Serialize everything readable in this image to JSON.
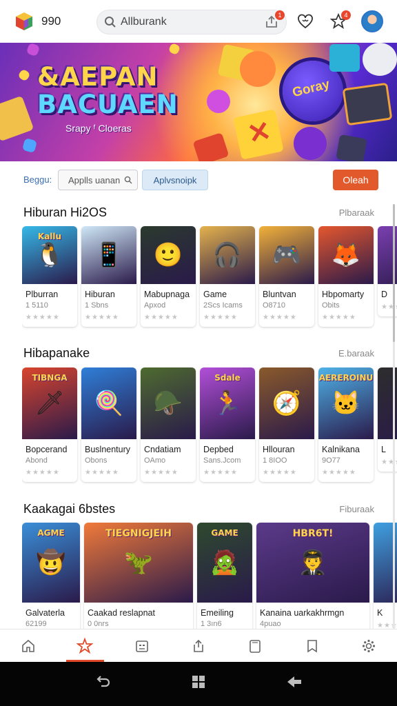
{
  "header": {
    "coins": "990",
    "search_value": "Allburank",
    "share_badge": "1",
    "favorites_badge": "4"
  },
  "banner": {
    "title_line1": "&AEPAN",
    "title_line2": "BACUAEN",
    "subtitle": "Srapy ᶠ Cloeras",
    "ball_text": "Goray"
  },
  "filter": {
    "label": "Beggu:",
    "search_chip": "Applls uanan",
    "active_chip": "Aplvsnoipk",
    "clear_button": "Oleah"
  },
  "sections": [
    {
      "title": "Hiburan Hi2OS",
      "more": "Plbaraak",
      "items": [
        {
          "name": "Plburran",
          "meta": "1 5110",
          "icon": "penguin-game-icon",
          "caption": "Kallu",
          "bg": "#36b9e8"
        },
        {
          "name": "Hiburan",
          "meta": "1 Sbns",
          "icon": "person-phone-icon",
          "caption": "",
          "bg": "#cfe8f7"
        },
        {
          "name": "Mabupnaga",
          "meta": "Apxod",
          "icon": "person-portrait-icon",
          "caption": "",
          "bg": "#2b3a2e"
        },
        {
          "name": "Game",
          "meta": "2Scs Icams",
          "icon": "headphones-girl-icon",
          "caption": "",
          "bg": "#e4b24c"
        },
        {
          "name": "Bluntvan",
          "meta": "O8710",
          "icon": "gamepad-icon",
          "caption": "",
          "bg": "#f2b13a"
        },
        {
          "name": "Hbpomarty",
          "meta": "Obits",
          "icon": "fox-girl-icon",
          "caption": "",
          "bg": "#e4572e"
        },
        {
          "name": "D",
          "meta": "",
          "icon": "partial-card-icon",
          "caption": "",
          "bg": "#7a3fb0"
        }
      ]
    },
    {
      "title": "Hibapanake",
      "more": "E.baraak",
      "items": [
        {
          "name": "Bopcerand",
          "meta": "Abond",
          "icon": "hero-adventure-icon",
          "caption": "TIBNGA",
          "bg": "#d8452e"
        },
        {
          "name": "Buslnentury",
          "meta": "Obons",
          "icon": "popsicle-icon",
          "caption": "",
          "bg": "#2f7fd8"
        },
        {
          "name": "Cndatiam",
          "meta": "OAmo",
          "icon": "soldiers-icon",
          "caption": "",
          "bg": "#4e6b2f"
        },
        {
          "name": "Depbed",
          "meta": "Sans.Jcom",
          "icon": "runner-icon",
          "caption": "Sdale",
          "bg": "#b24fd8"
        },
        {
          "name": "Hllouran",
          "meta": "1 8IOO",
          "icon": "explorer-icon",
          "caption": "",
          "bg": "#8a5a2b"
        },
        {
          "name": "Kalnikana",
          "meta": "9O77",
          "icon": "cat-hero-icon",
          "caption": "AEREROINU",
          "bg": "#4fb2e8"
        },
        {
          "name": "L",
          "meta": "",
          "icon": "partial-card-icon",
          "caption": "",
          "bg": "#2d2d2d"
        }
      ]
    },
    {
      "title": "Kaakagai 6bstes",
      "more": "Fiburaak",
      "items": [
        {
          "name": "Galvaterla",
          "meta": "62199",
          "icon": "farmer-icon",
          "caption": "AGME",
          "bg": "#3a8fd8"
        },
        {
          "name": "Caakad reslapnat",
          "meta": "0 0nrs",
          "icon": "dino-cat-icon",
          "caption": "TIEGNIGJEIH",
          "bg": "#f07a3a"
        },
        {
          "name": "Emeiling",
          "meta": "1 3ın6",
          "icon": "zombie-icon",
          "caption": "GAME",
          "bg": "#2e4a2e"
        },
        {
          "name": "Kanaina uarkakhrmgn",
          "meta": "4puao",
          "icon": "pilot-icon",
          "caption": "HBR6T!",
          "bg": "#5b3a8a"
        },
        {
          "name": "K",
          "meta": "",
          "icon": "partial-card-icon",
          "caption": "",
          "bg": "#3fa0e0"
        }
      ]
    }
  ],
  "bottom_nav": [
    "home-icon",
    "starfish-icon",
    "robot-icon",
    "share-icon",
    "tablet-icon",
    "bookmark-icon",
    "settings-icon"
  ],
  "system_nav": [
    "back-gesture-icon",
    "apps-grid-icon",
    "back-arrow-icon"
  ],
  "colors": {
    "accent": "#e25a2b",
    "link": "#3b6fb0"
  }
}
